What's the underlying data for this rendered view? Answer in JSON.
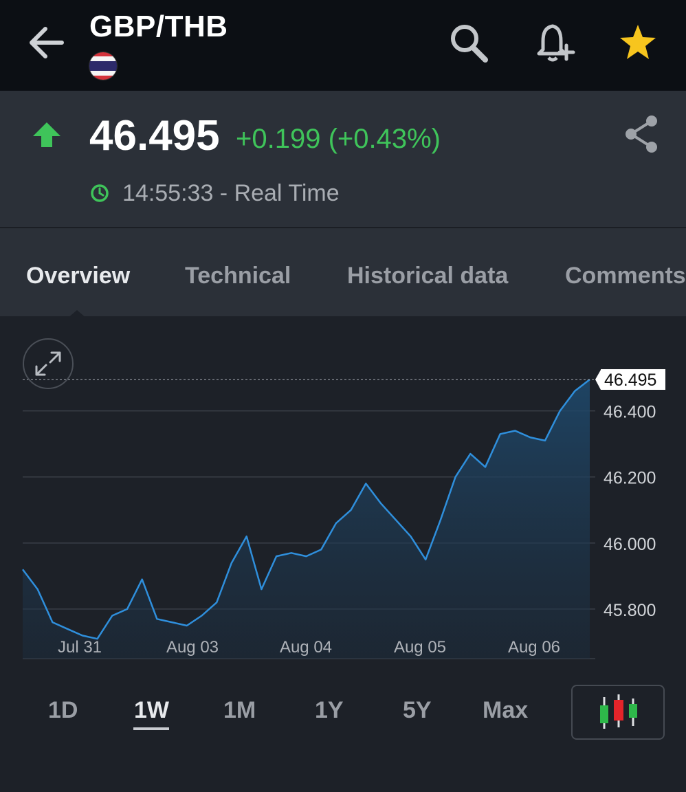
{
  "header": {
    "title": "GBP/THB",
    "icons": [
      "back-arrow-icon",
      "thai-flag-icon",
      "search-icon",
      "add-alert-icon",
      "star-icon"
    ]
  },
  "quote": {
    "price": "46.495",
    "change": "+0.199 (+0.43%)",
    "time": "14:55:33 - Real Time",
    "direction": "up",
    "colors": {
      "up": "#3fc45a",
      "star": "#f7c51e",
      "line": "#2f8fdc"
    }
  },
  "tabs": [
    {
      "label": "Overview",
      "active": true
    },
    {
      "label": "Technical",
      "active": false
    },
    {
      "label": "Historical data",
      "active": false
    },
    {
      "label": "Comments",
      "active": false
    }
  ],
  "chart_data": {
    "type": "area",
    "x": [
      "Jul 31 00:00",
      "Jul 31 04:00",
      "Jul 31 08:00",
      "Jul 31 12:00",
      "Jul 31 16:00",
      "Jul 31 20:00",
      "Aug 03 00:00",
      "Aug 03 04:00",
      "Aug 03 08:00",
      "Aug 03 12:00",
      "Aug 03 16:00",
      "Aug 03 20:00",
      "Aug 04 00:00",
      "Aug 04 04:00",
      "Aug 04 08:00",
      "Aug 04 12:00",
      "Aug 04 16:00",
      "Aug 04 20:00",
      "Aug 05 00:00",
      "Aug 05 04:00",
      "Aug 05 08:00",
      "Aug 05 12:00",
      "Aug 05 16:00",
      "Aug 05 20:00",
      "Aug 06 00:00",
      "Aug 06 04:00",
      "Aug 06 08:00",
      "Aug 06 12:00"
    ],
    "values": [
      45.92,
      45.86,
      45.76,
      45.74,
      45.72,
      45.71,
      45.78,
      45.8,
      45.89,
      45.77,
      45.76,
      45.75,
      45.78,
      45.82,
      45.94,
      46.02,
      45.86,
      45.96,
      45.97,
      45.96,
      45.98,
      46.06,
      46.1,
      46.18,
      46.12,
      46.07,
      46.02,
      45.95
    ],
    "values_tail": [
      46.07,
      46.2,
      46.27,
      46.23,
      46.33,
      46.34,
      46.32,
      46.31,
      46.4,
      46.46,
      46.495
    ],
    "x_ticks": [
      "Jul 31",
      "Aug 03",
      "Aug 04",
      "Aug 05",
      "Aug 06"
    ],
    "y_ticks": [
      "46.400",
      "46.200",
      "46.000",
      "45.800"
    ],
    "ylim": [
      45.65,
      46.52
    ],
    "last_value_label": "46.495",
    "grid": true,
    "axis_position": "right"
  },
  "ranges": [
    {
      "label": "1D",
      "active": false
    },
    {
      "label": "1W",
      "active": true
    },
    {
      "label": "1M",
      "active": false
    },
    {
      "label": "1Y",
      "active": false
    },
    {
      "label": "5Y",
      "active": false
    },
    {
      "label": "Max",
      "active": false
    }
  ],
  "chart_type_button": {
    "icon": "candlestick-icon"
  },
  "expand_button": {
    "icon": "expand-icon"
  }
}
